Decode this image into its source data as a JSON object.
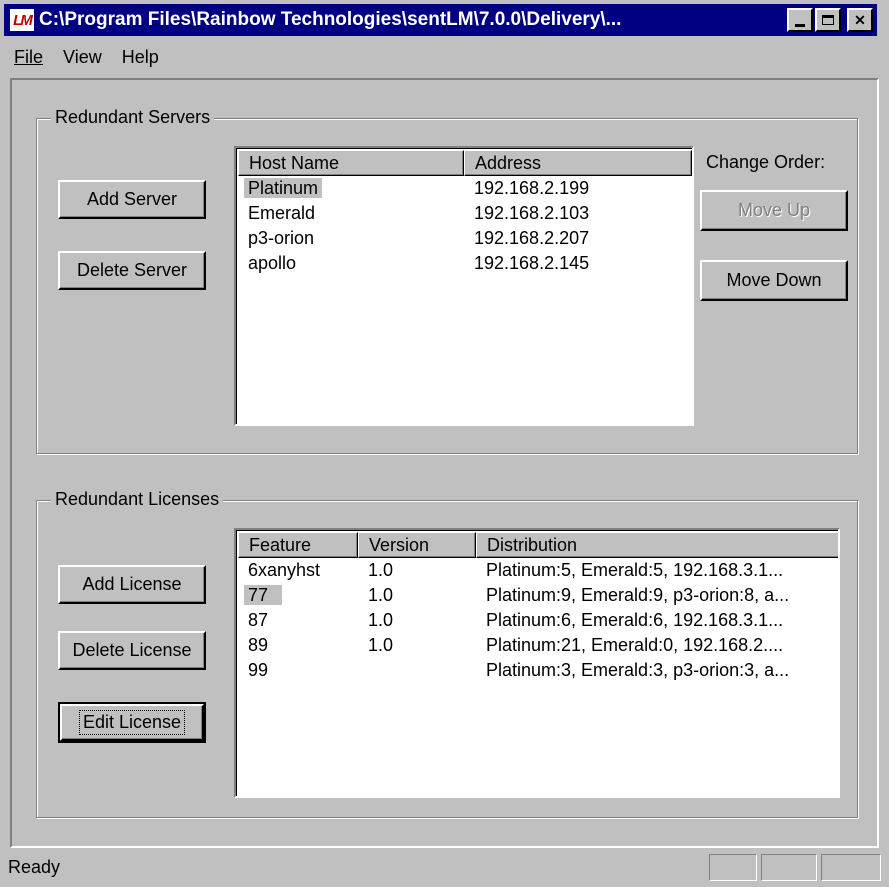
{
  "window": {
    "title": "C:\\Program Files\\Rainbow Technologies\\sentLM\\7.0.0\\Delivery\\...",
    "icon": "LM",
    "controls": [
      "minimize-icon",
      "maximize-icon",
      "close-icon"
    ]
  },
  "menu": [
    "File",
    "View",
    "Help"
  ],
  "servers": {
    "group_label": "Redundant Servers",
    "add_button": "Add Server",
    "delete_button": "Delete Server",
    "change_order_label": "Change Order:",
    "move_up_button": "Move Up",
    "move_down_button": "Move Down",
    "columns": [
      "Host Name",
      "Address"
    ],
    "rows": [
      {
        "host": "Platinum",
        "address": "192.168.2.199"
      },
      {
        "host": "Emerald",
        "address": "192.168.2.103"
      },
      {
        "host": "p3-orion",
        "address": "192.168.2.207"
      },
      {
        "host": "apollo",
        "address": "192.168.2.145"
      }
    ]
  },
  "licenses": {
    "group_label": "Redundant Licenses",
    "add_button": "Add License",
    "delete_button": "Delete License",
    "edit_button": "Edit License",
    "columns": [
      "Feature",
      "Version",
      "Distribution"
    ],
    "rows": [
      {
        "feature": "6xanyhst",
        "version": "1.0",
        "distribution": "Platinum:5, Emerald:5, 192.168.3.1..."
      },
      {
        "feature": "77",
        "version": "1.0",
        "distribution": "Platinum:9, Emerald:9, p3-orion:8, a..."
      },
      {
        "feature": "87",
        "version": "1.0",
        "distribution": "Platinum:6, Emerald:6, 192.168.3.1..."
      },
      {
        "feature": "89",
        "version": "1.0",
        "distribution": "Platinum:21, Emerald:0, 192.168.2...."
      },
      {
        "feature": "99",
        "version": "",
        "distribution": "Platinum:3, Emerald:3, p3-orion:3, a..."
      }
    ]
  },
  "status": {
    "text": "Ready"
  }
}
